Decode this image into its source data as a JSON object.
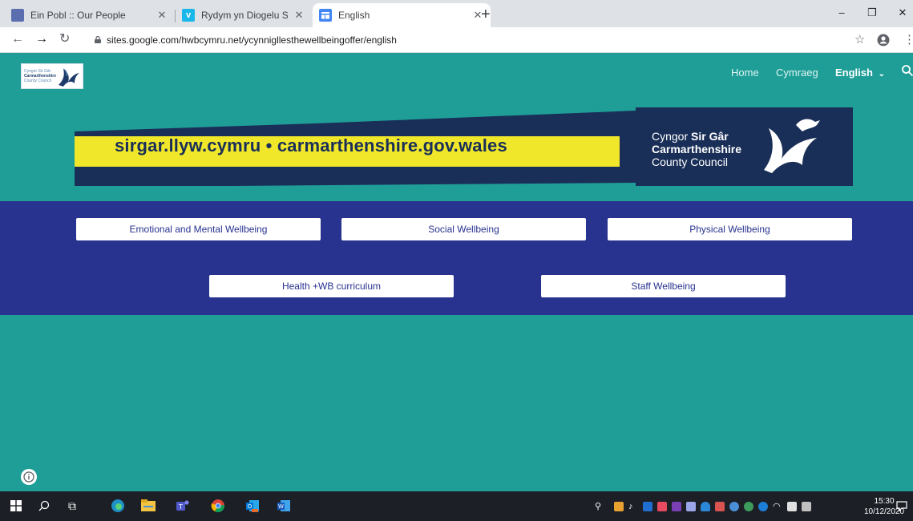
{
  "browser": {
    "tabs": [
      {
        "title": "Ein Pobl :: Our People",
        "favicon_color": "#5b6fb0"
      },
      {
        "title": "Rydym yn Diogelu Sir Gâr on Vim",
        "favicon_color": "#1ab7ea"
      },
      {
        "title": "English",
        "favicon_color": "#4285f4"
      }
    ],
    "active_tab": 2,
    "url": "sites.google.com/hwbcymru.net/ycynnigllesthewellbeingoffer/english"
  },
  "site": {
    "logo": {
      "line1": "Cyngor Sir Gâr",
      "line2": "Carmarthenshire",
      "line3": "County Council"
    },
    "nav": {
      "home": "Home",
      "cymraeg": "Cymraeg",
      "english": "English"
    },
    "banner": {
      "url_text": "sirgar.llyw.cymru • carmarthenshire.gov.wales",
      "cyngor": "Cyngor ",
      "sir_gar": "Sir Gâr",
      "carmarthenshire": "Carmarthenshire",
      "county_council": "County Council"
    },
    "buttons": {
      "emotional": "Emotional and Mental Wellbeing",
      "social": "Social Wellbeing",
      "physical": "Physical Wellbeing",
      "health": "Health +WB curriculum",
      "staff": "Staff Wellbeing"
    },
    "colors": {
      "teal": "#1f9e98",
      "navy": "#28328f",
      "yellow": "#f0e72a",
      "banner_dark": "#1a2f58"
    }
  },
  "taskbar": {
    "time": "15:30",
    "date": "10/12/2020"
  }
}
